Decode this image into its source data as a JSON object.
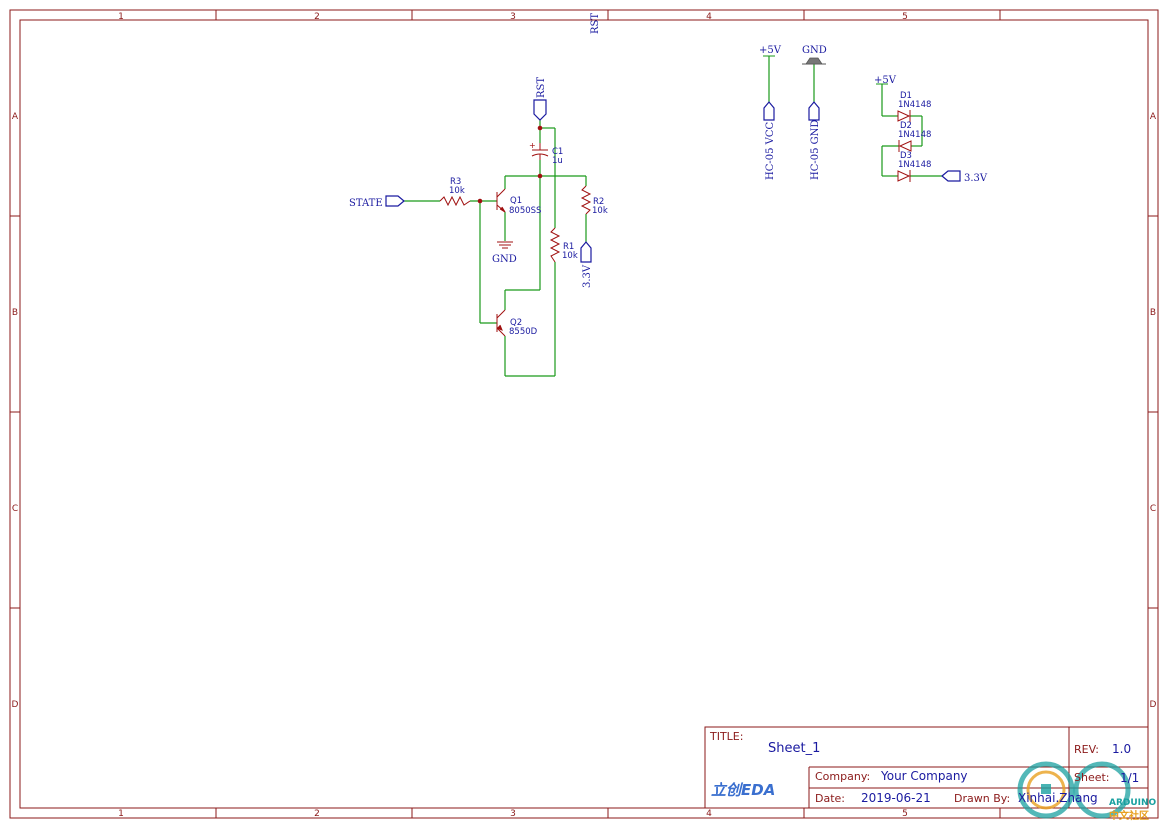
{
  "sheet": {
    "column_numbers": [
      "1",
      "2",
      "3",
      "4",
      "5"
    ],
    "row_letters": [
      "A",
      "B",
      "C",
      "D"
    ]
  },
  "nets": {
    "rst_top": "RST",
    "rst": "RST",
    "state": "STATE",
    "gnd_q1": "GND",
    "vcc_power": "+5V",
    "gnd_power": "GND",
    "hc05_vcc": "HC-05 VCC",
    "hc05_gnd": "HC-05 GND",
    "diode_vcc": "+5V",
    "out_3v3": "3.3V",
    "r2_3v3": "3.3V"
  },
  "components": {
    "C1": {
      "ref": "C1",
      "value": "1u"
    },
    "R1": {
      "ref": "R1",
      "value": "10k"
    },
    "R2": {
      "ref": "R2",
      "value": "10k"
    },
    "R3": {
      "ref": "R3",
      "value": "10k"
    },
    "Q1": {
      "ref": "Q1",
      "value": "8050SS"
    },
    "Q2": {
      "ref": "Q2",
      "value": "8550D"
    },
    "D1": {
      "ref": "D1",
      "value": "1N4148"
    },
    "D2": {
      "ref": "D2",
      "value": "1N4148"
    },
    "D3": {
      "ref": "D3",
      "value": "1N4148"
    }
  },
  "titleblock": {
    "title_label": "TITLE:",
    "title_value": "Sheet_1",
    "rev_label": "REV:",
    "rev_value": "1.0",
    "company_label": "Company:",
    "company_value": "Your Company",
    "sheet_label": "Sheet:",
    "sheet_value": "1/1",
    "date_label": "Date:",
    "date_value": "2019-06-21",
    "drawn_label": "Drawn By:",
    "drawn_value": "Xinhai.Zhang",
    "logo_text": "立创EDA",
    "watermark_en": "ARDUINO",
    "watermark_cn": "中文社区"
  },
  "colors": {
    "frame": "#8b1a1a",
    "wire": "#1a9a1a",
    "net_label": "#1a1aa0",
    "junction": "#a01010",
    "symbol": "#a01010"
  }
}
